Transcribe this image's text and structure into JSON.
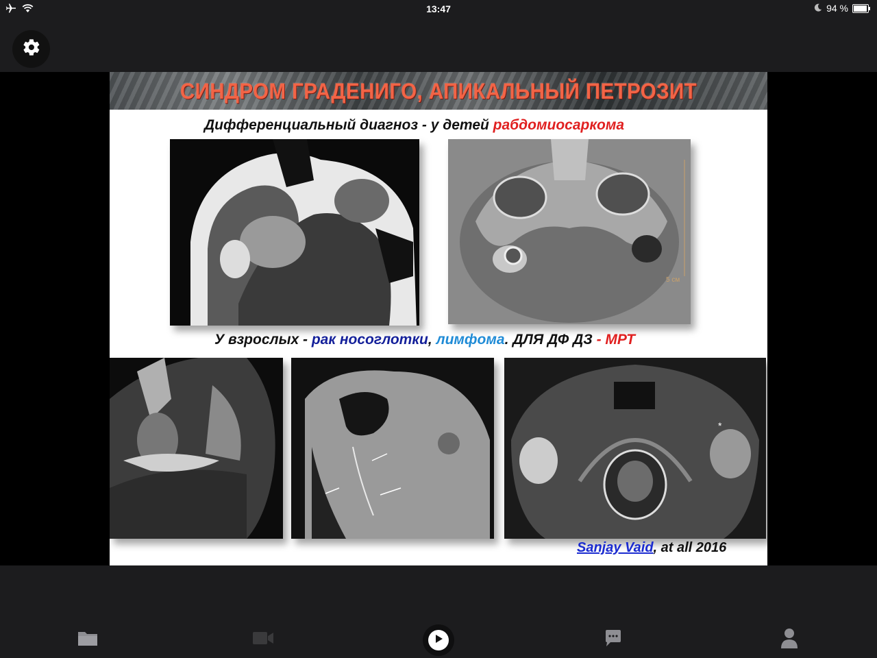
{
  "status_bar": {
    "time": "13:47",
    "battery_text": "94 %",
    "battery_level": 0.94,
    "icons": [
      "airplane-icon",
      "wifi-icon",
      "moon-icon",
      "battery-icon"
    ]
  },
  "settings": {
    "icon": "gear-icon"
  },
  "slide": {
    "title": "СИНДРОМ ГРАДЕНИГО, АПИКАЛЬНЫЙ ПЕТРОЗИТ",
    "line1": {
      "part1": "Дифференциальный диагноз  - у детей ",
      "part2": "рабдомиосаркома"
    },
    "line2": {
      "part1": "У взрослых -  ",
      "part2": "рак носоглотки",
      "part3": ", ",
      "part4": "лимфома",
      "part5": ".  ДЛЯ ДФ ДЗ  ",
      "part6": "- МРТ"
    },
    "scan_annotation_scale": "5 см",
    "credit": {
      "link": "Sanjay Vaid",
      "rest": ", at all 2016"
    },
    "colors": {
      "title": "#f26446",
      "red": "#e02020",
      "navy": "#14209a",
      "blue": "#1f8bd6",
      "link": "#1a2bd0"
    }
  },
  "toolbar": {
    "items": [
      "folder-icon",
      "video-camera-icon",
      "play-icon",
      "chat-icon",
      "person-icon"
    ]
  }
}
